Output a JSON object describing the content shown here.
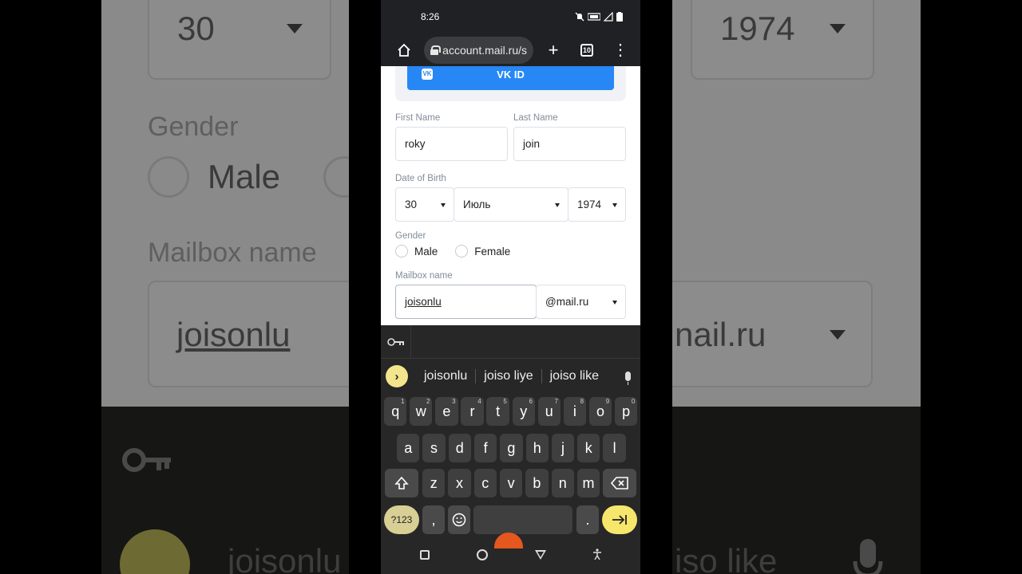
{
  "background": {
    "day_value": "30",
    "year_value": "1974",
    "gender_label": "Gender",
    "male_label": "Male",
    "mailbox_label": "Mailbox name",
    "mailbox_value": "joisonlu",
    "domain_value": "nail.ru",
    "suggestion_left": "joisonlu",
    "suggestion_right": "iso like"
  },
  "status_bar": {
    "time": "8:26"
  },
  "browser": {
    "url": "account.mail.ru/s",
    "tab_count": "10"
  },
  "form": {
    "vk_button_label": "VK ID",
    "first_name_label": "First Name",
    "first_name_value": "roky",
    "last_name_label": "Last Name",
    "last_name_value": "join",
    "dob_label": "Date of Birth",
    "dob_day": "30",
    "dob_month": "Июль",
    "dob_year": "1974",
    "gender_label": "Gender",
    "gender_options": [
      "Male",
      "Female"
    ],
    "mailbox_label": "Mailbox name",
    "mailbox_value": "joisonlu",
    "domain_value": "@mail.ru"
  },
  "keyboard": {
    "suggestions": [
      "joisonlu",
      "joiso liye",
      "joiso like"
    ],
    "row1": [
      {
        "k": "q",
        "n": "1"
      },
      {
        "k": "w",
        "n": "2"
      },
      {
        "k": "e",
        "n": "3"
      },
      {
        "k": "r",
        "n": "4"
      },
      {
        "k": "t",
        "n": "5"
      },
      {
        "k": "y",
        "n": "6"
      },
      {
        "k": "u",
        "n": "7"
      },
      {
        "k": "i",
        "n": "8"
      },
      {
        "k": "o",
        "n": "9"
      },
      {
        "k": "p",
        "n": "0"
      }
    ],
    "row2": [
      "a",
      "s",
      "d",
      "f",
      "g",
      "h",
      "j",
      "k",
      "l"
    ],
    "row3": [
      "z",
      "x",
      "c",
      "v",
      "b",
      "n",
      "m"
    ],
    "symbols_label": "?123",
    "comma_label": ",",
    "period_label": "."
  }
}
